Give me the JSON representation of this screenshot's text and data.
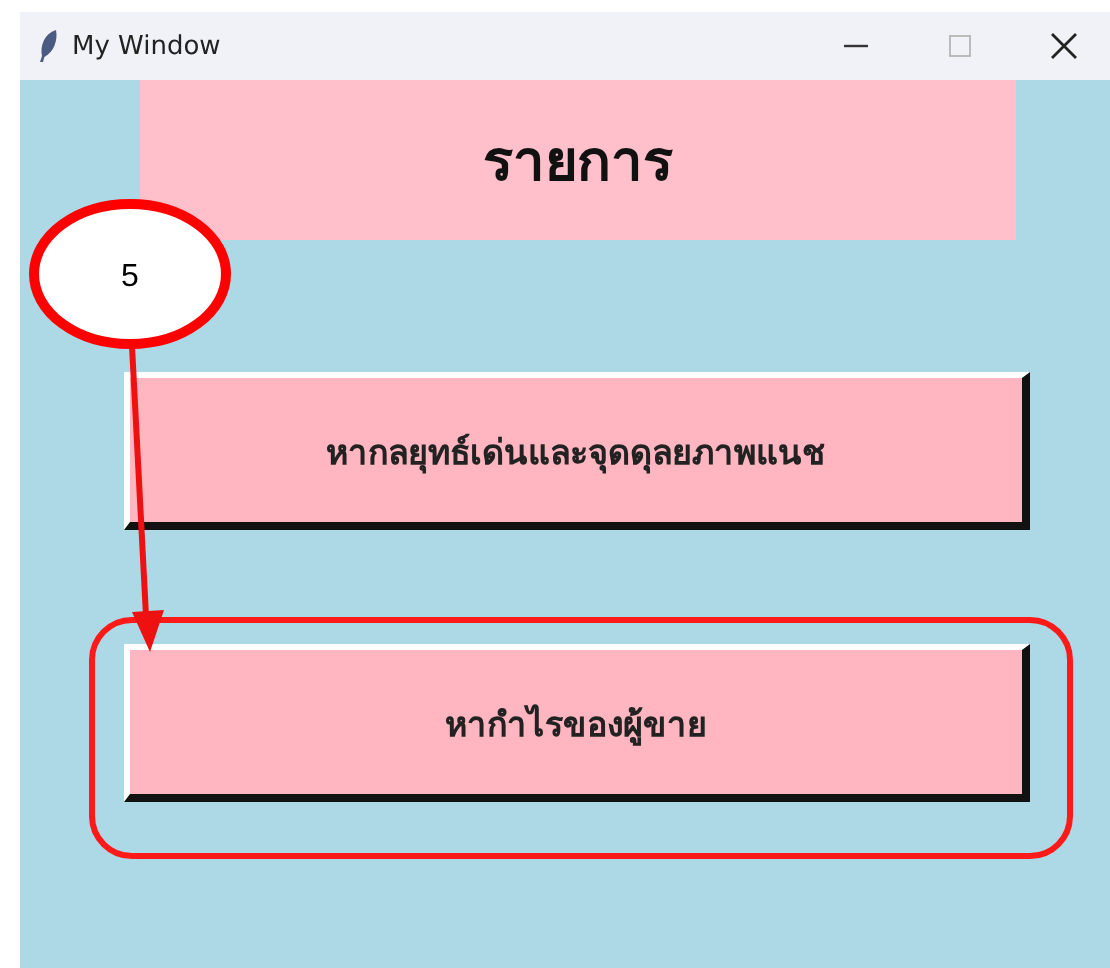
{
  "window": {
    "title": "My Window"
  },
  "heading": "รายการ",
  "buttons": [
    {
      "label": "หากลยุทธ์เด่นและจุดดุลยภาพแนช",
      "highlighted": false
    },
    {
      "label": "หากำไรของผู้ขาย",
      "highlighted": true
    }
  ],
  "callout": {
    "label": "5"
  }
}
